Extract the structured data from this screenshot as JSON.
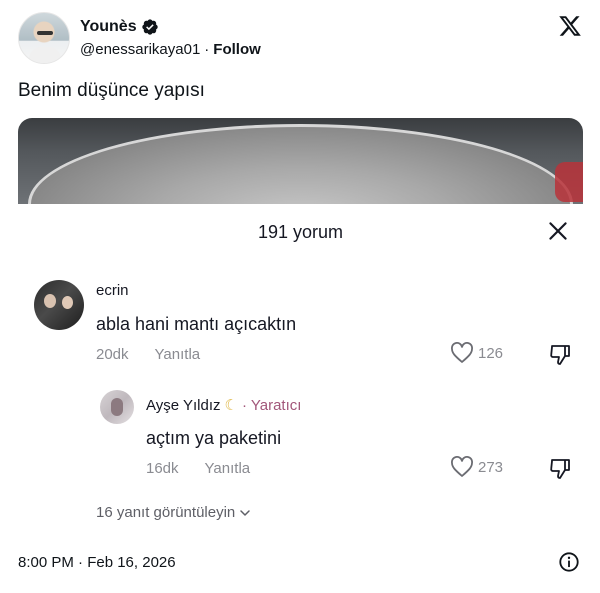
{
  "tweet": {
    "author_name": "Younès",
    "handle": "@enessarikaya01",
    "follow_label": "Follow",
    "separator": "·",
    "text": "Benim düşünce yapısı",
    "timestamp": "8:00 PM · Feb 16, 2026"
  },
  "comments_panel": {
    "title": "191 yorum",
    "view_replies": "16 yanıt görüntüleyin",
    "comments": [
      {
        "username": "ecrin",
        "text": "abla hani mantı açıcaktın",
        "age": "20dk",
        "reply_label": "Yanıtla",
        "likes": "126"
      },
      {
        "username": "Ayşe Yıldız",
        "badge": "· Yaratıcı",
        "text": "açtım ya paketini",
        "age": "16dk",
        "reply_label": "Yanıtla",
        "likes": "273"
      }
    ]
  },
  "icons": {
    "verified": "verified-badge-icon",
    "brand": "x-logo-icon",
    "close": "close-icon",
    "like": "heart-icon",
    "dislike": "thumbs-down-icon",
    "chevron": "chevron-down-icon",
    "info": "info-icon",
    "moon": "crescent-moon-icon"
  },
  "colors": {
    "text": "#0f1419",
    "meta": "#8a8b91",
    "creator_badge": "#a2577a"
  }
}
